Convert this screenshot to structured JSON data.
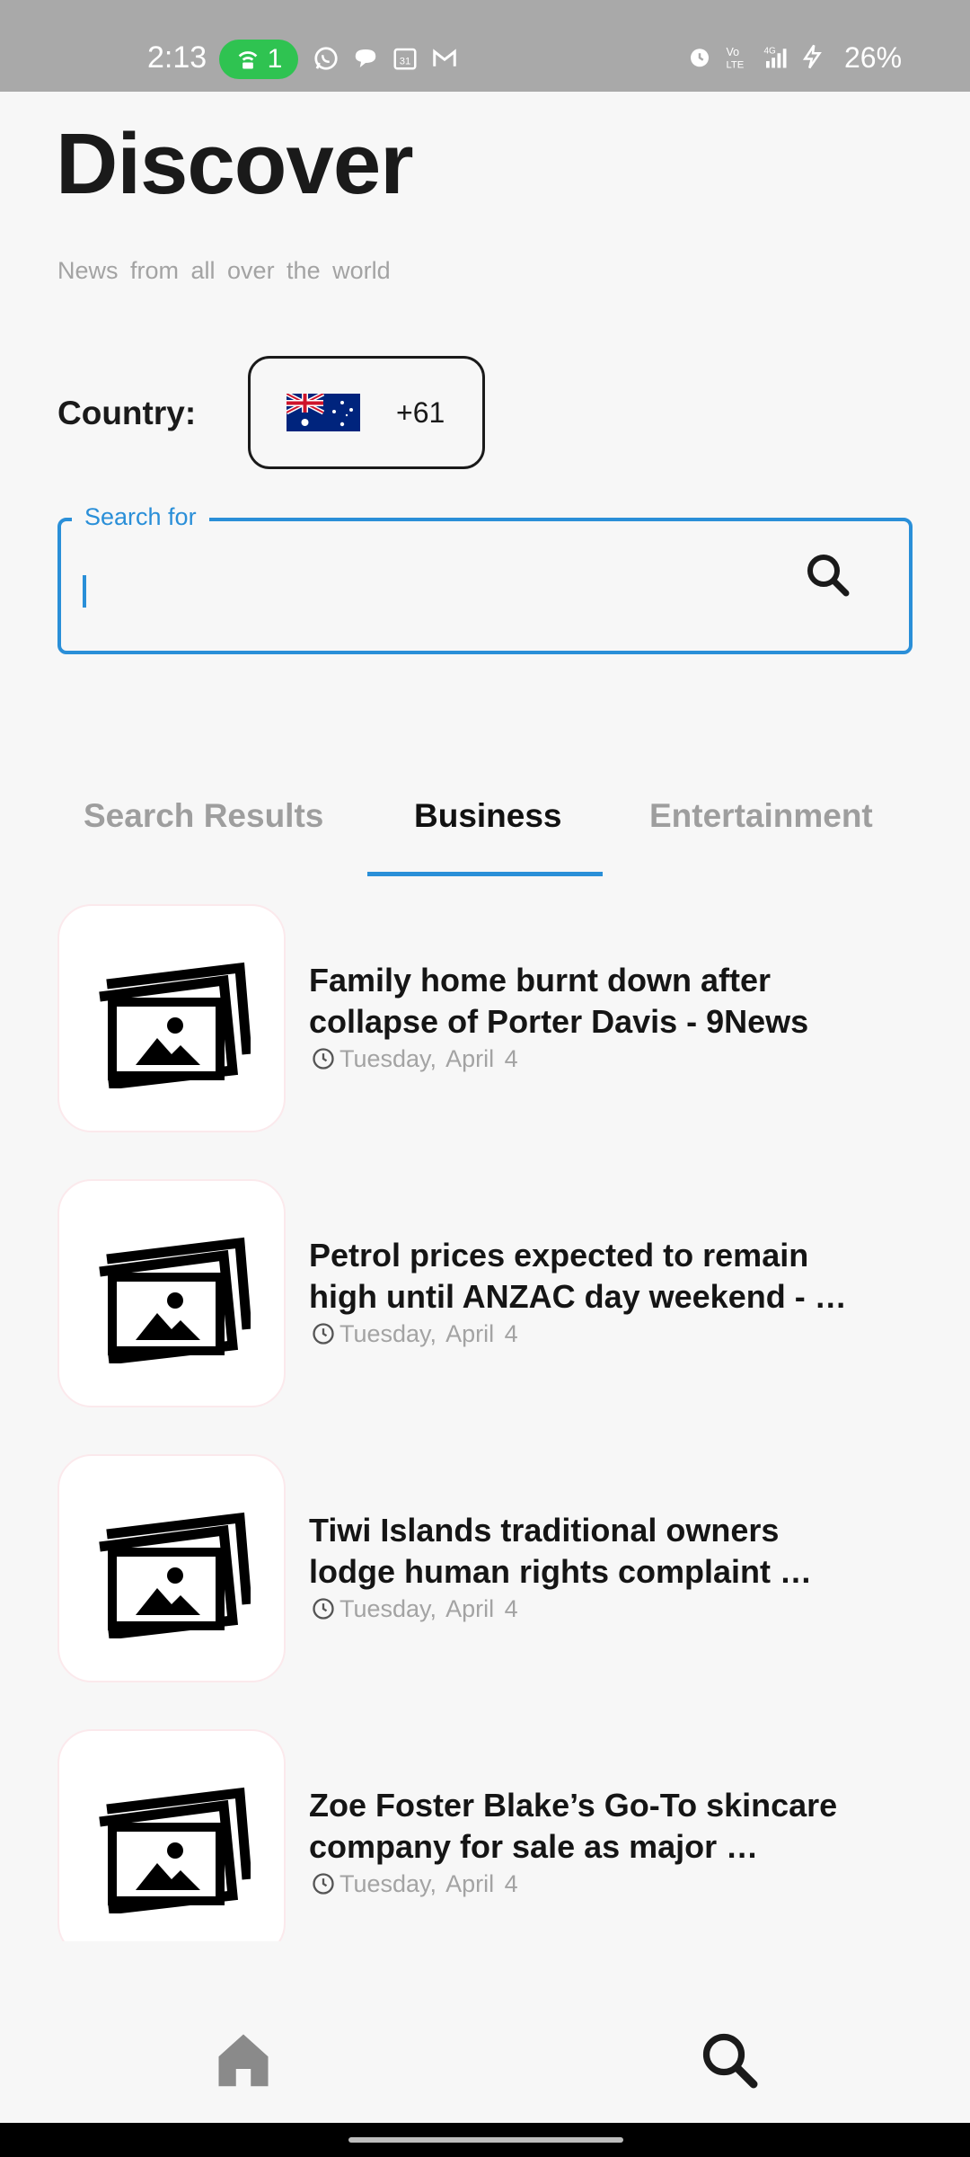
{
  "status_bar": {
    "time": "2:13",
    "hotspot_count": "1",
    "battery": "26%",
    "left_icons": [
      "whatsapp-icon",
      "chat-bubble-icon",
      "calendar-icon",
      "gmail-icon"
    ],
    "right_icons": [
      "alarm-icon",
      "volte-icon",
      "signal-4g-icon",
      "charging-icon"
    ]
  },
  "header": {
    "title": "Discover",
    "subtitle": "News from all over the world"
  },
  "country": {
    "label": "Country:",
    "flag": "australia-flag",
    "dial_code": "+61"
  },
  "search": {
    "label": "Search for",
    "value": "",
    "accent_color": "#2a8fd8"
  },
  "tabs": [
    {
      "label": "Search Results",
      "active": false
    },
    {
      "label": "Business",
      "active": true
    },
    {
      "label": "Entertainment",
      "active": false
    }
  ],
  "news": [
    {
      "title_line1": "Family home burnt down after",
      "title_line2": "collapse of Porter Davis - 9News",
      "date": "Tuesday, April 4"
    },
    {
      "title_line1": "Petrol prices expected to remain",
      "title_line2": "high until ANZAC day weekend - …",
      "date": "Tuesday, April 4"
    },
    {
      "title_line1": "Tiwi Islands traditional owners",
      "title_line2": "lodge human rights complaint …",
      "date": "Tuesday, April 4"
    },
    {
      "title_line1": "Zoe Foster Blake’s Go-To skincare",
      "title_line2": "company for sale as major …",
      "date": "Tuesday, April 4"
    }
  ],
  "bottom_nav": {
    "items": [
      "home-icon",
      "search-icon"
    ]
  }
}
